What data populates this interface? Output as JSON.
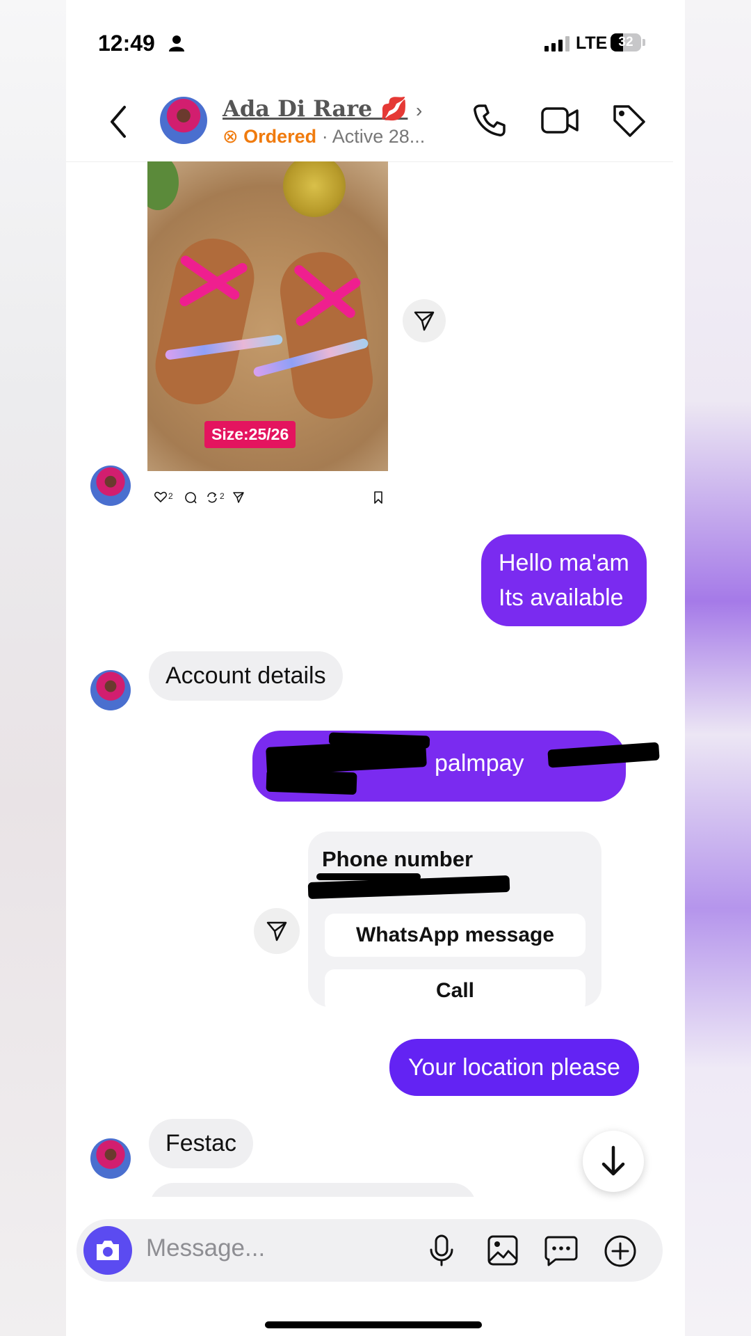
{
  "status_bar": {
    "time": "12:49",
    "network": "LTE",
    "battery": "32"
  },
  "header": {
    "contact_name": "Ada Di Rare 💋",
    "ordered_label": "Ordered",
    "separator": "·",
    "active_text": "Active 28..."
  },
  "post": {
    "size_tag": "Size:25/26",
    "likes": "2",
    "reposts": "2"
  },
  "messages": {
    "m1_line1": "Hello ma'am",
    "m1_line2": "Its available",
    "m2": "Account details",
    "m3_visible": "palmpay",
    "m4": "Your location please",
    "m5": "Festac"
  },
  "phone_card": {
    "title": "Phone number",
    "whatsapp_label": "WhatsApp message",
    "call_label": "Call"
  },
  "composer": {
    "placeholder": "Message..."
  },
  "colors": {
    "accent_purple": "#7a2bf0",
    "ordered_orange": "#f07b0e",
    "camera_button": "#5b4bf1"
  },
  "icons": [
    "back-icon",
    "chevron-right-icon",
    "phone-icon",
    "video-icon",
    "tag-icon",
    "share-icon",
    "heart-icon",
    "comment-icon",
    "repost-icon",
    "bookmark-icon",
    "arrow-down-icon",
    "camera-icon",
    "microphone-icon",
    "image-icon",
    "sticker-icon",
    "plus-icon"
  ]
}
